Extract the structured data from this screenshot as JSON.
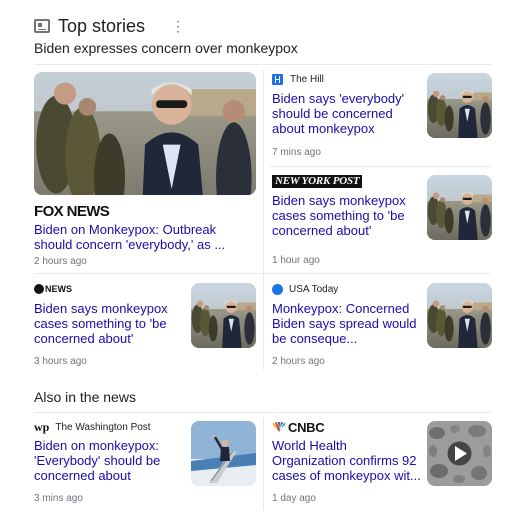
{
  "header": {
    "title": "Top stories",
    "more_glyph": "⋮",
    "icon": "news-icon"
  },
  "story_heading": "Biden expresses concern over monkeypox",
  "also_heading": "Also in the news",
  "colors": {
    "link": "#1a0dab",
    "meta": "#70757a",
    "divider": "#ebebeb"
  },
  "stories": [
    {
      "source": "FOX NEWS",
      "title": "Biden on Monkeypox: Outbreak should concern 'everybody,' as ...",
      "time": "2 hours ago",
      "thumb": "photo-biden-press"
    },
    {
      "source": "The Hill",
      "title": "Biden says 'everybody' should be concerned about monkeypox",
      "time": "7 mins ago",
      "thumb": "photo-biden-press"
    },
    {
      "source": "NEW YORK POST",
      "title": "Biden says monkeypox cases something to 'be concerned about'",
      "time": "1 hour ago",
      "thumb": "photo-biden-press"
    },
    {
      "source": "NEWS",
      "title": "Biden says monkeypox cases something to 'be concerned about'",
      "time": "3 hours ago",
      "thumb": "photo-biden-press"
    },
    {
      "source": "USA Today",
      "title": "Monkeypox: Concerned Biden says spread would be conseque...",
      "time": "2 hours ago",
      "thumb": "photo-biden-press"
    },
    {
      "source": "The Washington Post",
      "title": "Biden on monkeypox: 'Everybody' should be concerned about spread",
      "time": "3 mins ago",
      "thumb": "photo-biden-plane-stairs"
    },
    {
      "source": "CNBC",
      "title": "World Health Organization confirms 92 cases of monkeypox wit...",
      "time": "1 day ago",
      "thumb": "video-virus-microscope"
    }
  ]
}
